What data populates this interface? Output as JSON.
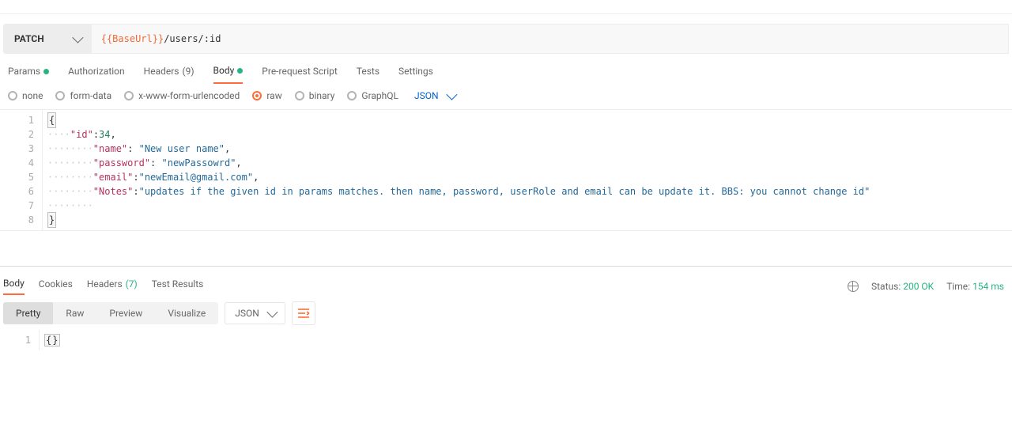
{
  "request": {
    "method": "PATCH",
    "url_variable": "{{BaseUrl}}",
    "url_path": "/users/:id"
  },
  "tabs": {
    "params": "Params",
    "authorization": "Authorization",
    "headers_label": "Headers",
    "headers_count": "(9)",
    "body": "Body",
    "prerequest": "Pre-request Script",
    "tests": "Tests",
    "settings": "Settings"
  },
  "body_types": {
    "none": "none",
    "formdata": "form-data",
    "urlencoded": "x-www-form-urlencoded",
    "raw": "raw",
    "binary": "binary",
    "graphql": "GraphQL",
    "json_label": "JSON"
  },
  "editor": {
    "lines": [
      "1",
      "2",
      "3",
      "4",
      "5",
      "6",
      "7",
      "8"
    ],
    "code": [
      {
        "prefix": "",
        "indent": "",
        "content": [
          [
            "brace-open",
            "{"
          ]
        ]
      },
      {
        "prefix": "····",
        "indent": "",
        "content": [
          [
            "key",
            "\"id\""
          ],
          [
            "punc",
            ":"
          ],
          [
            "num",
            "34"
          ],
          [
            "punc",
            ","
          ]
        ]
      },
      {
        "prefix": "········",
        "indent": "",
        "content": [
          [
            "key",
            "\"name\""
          ],
          [
            "punc",
            ": "
          ],
          [
            "str",
            "\"New user name\""
          ],
          [
            "punc",
            ","
          ]
        ]
      },
      {
        "prefix": "········",
        "indent": "",
        "content": [
          [
            "key",
            "\"password\""
          ],
          [
            "punc",
            ": "
          ],
          [
            "str",
            "\"newPassowrd\""
          ],
          [
            "punc",
            ","
          ]
        ]
      },
      {
        "prefix": "········",
        "indent": "",
        "content": [
          [
            "key",
            "\"email\""
          ],
          [
            "punc",
            ":"
          ],
          [
            "str",
            "\"newEmail@gmail.com\""
          ],
          [
            "punc",
            ","
          ]
        ]
      },
      {
        "prefix": "········",
        "indent": "",
        "content": [
          [
            "key",
            "\"Notes\""
          ],
          [
            "punc",
            ":"
          ],
          [
            "str",
            "\"updates if the given id in params matches. then name, password, userRole and email can be update it. BBS: you cannot change id\""
          ]
        ]
      },
      {
        "prefix": "········",
        "indent": "",
        "content": []
      },
      {
        "prefix": "",
        "indent": "",
        "content": [
          [
            "brace-close",
            "}"
          ]
        ]
      }
    ]
  },
  "response": {
    "tabs": {
      "body": "Body",
      "cookies": "Cookies",
      "headers_label": "Headers",
      "headers_count": "(7)",
      "test_results": "Test Results"
    },
    "status_label": "Status:",
    "status_value": "200 OK",
    "time_label": "Time:",
    "time_value": "154 ms",
    "view_modes": {
      "pretty": "Pretty",
      "raw": "Raw",
      "preview": "Preview",
      "visualize": "Visualize"
    },
    "format_label": "JSON",
    "body_lines": [
      "1"
    ],
    "body_content": "{}"
  }
}
